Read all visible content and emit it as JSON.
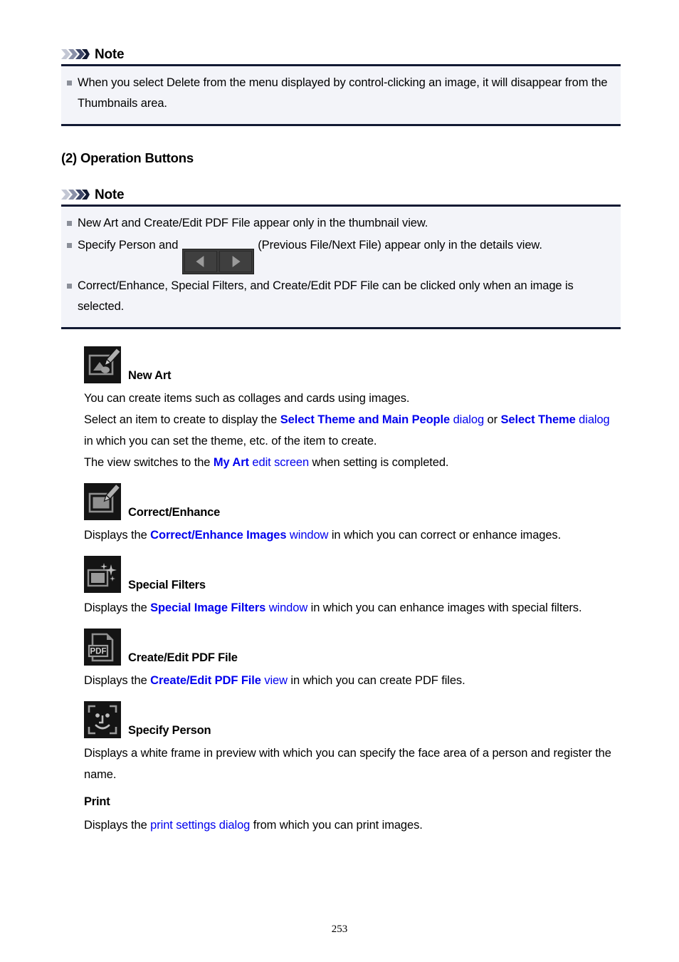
{
  "note1": {
    "title": "Note",
    "icon": "chevrons-right-icon",
    "items": [
      {
        "parts": [
          {
            "t": "When you select ",
            "s": "plain"
          },
          {
            "t": "Delete",
            "s": "bold"
          },
          {
            "t": " from the menu displayed by control-clicking an image, it will disappear from the Thumbnails area.",
            "s": "plain"
          }
        ]
      }
    ]
  },
  "section": {
    "heading": "(2) Operation Buttons"
  },
  "note2": {
    "title": "Note",
    "icon": "chevrons-right-icon",
    "items": [
      {
        "parts": [
          {
            "t": "New Art",
            "s": "bold"
          },
          {
            "t": " and ",
            "s": "plain"
          },
          {
            "t": "Create/Edit PDF File",
            "s": "bold"
          },
          {
            "t": " appear only in the thumbnail view.",
            "s": "plain"
          }
        ]
      },
      {
        "parts": [
          {
            "t": "Specify Person",
            "s": "bold"
          },
          {
            "t": " and ",
            "s": "plain"
          },
          {
            "t": "",
            "s": "navbuttons"
          },
          {
            "t": " (Previous File/Next File) appear only in the details view.",
            "s": "plain"
          }
        ]
      },
      {
        "parts": [
          {
            "t": "Correct/Enhance",
            "s": "bold"
          },
          {
            "t": ", ",
            "s": "plain"
          },
          {
            "t": "Special Filters",
            "s": "bold"
          },
          {
            "t": ", and ",
            "s": "plain"
          },
          {
            "t": "Create/Edit PDF File",
            "s": "bold"
          },
          {
            "t": " can be clicked only when an image is selected.",
            "s": "plain"
          }
        ]
      }
    ],
    "nav_buttons": {
      "previous_label": "Previous File",
      "next_label": "Next File",
      "previous_icon": "arrow-left-icon",
      "next_icon": "arrow-right-icon"
    }
  },
  "buttons": [
    {
      "icon": "new-art-icon",
      "label": "New Art",
      "description_parts": [
        {
          "t": "You can create items such as collages and cards using images.",
          "s": "plain"
        },
        {
          "t": "\n",
          "s": "break"
        },
        {
          "t": "Select an item to create to display the ",
          "s": "plain"
        },
        {
          "t": "Select Theme and Main People",
          "s": "link-bold"
        },
        {
          "t": " dialog",
          "s": "link"
        },
        {
          "t": " or ",
          "s": "plain"
        },
        {
          "t": "Select Theme",
          "s": "link-bold"
        },
        {
          "t": " dialog",
          "s": "link"
        },
        {
          "t": " in which you can set the theme, etc. of the item to create.",
          "s": "plain"
        },
        {
          "t": "\n",
          "s": "break"
        },
        {
          "t": "The view switches to the ",
          "s": "plain"
        },
        {
          "t": "My Art",
          "s": "link-bold"
        },
        {
          "t": " edit screen",
          "s": "link"
        },
        {
          "t": " when setting is completed.",
          "s": "plain"
        }
      ]
    },
    {
      "icon": "correct-enhance-icon",
      "label": "Correct/Enhance",
      "description_parts": [
        {
          "t": "Displays the ",
          "s": "plain"
        },
        {
          "t": "Correct/Enhance Images",
          "s": "link-bold"
        },
        {
          "t": " window",
          "s": "link"
        },
        {
          "t": " in which you can correct or enhance images.",
          "s": "plain"
        }
      ]
    },
    {
      "icon": "special-filters-icon",
      "label": "Special Filters",
      "description_parts": [
        {
          "t": "Displays the ",
          "s": "plain"
        },
        {
          "t": "Special Image Filters",
          "s": "link-bold"
        },
        {
          "t": " window",
          "s": "link"
        },
        {
          "t": " in which you can enhance images with special filters.",
          "s": "plain"
        }
      ]
    },
    {
      "icon": "create-edit-pdf-icon",
      "label": "Create/Edit PDF File",
      "description_parts": [
        {
          "t": "Displays the ",
          "s": "plain"
        },
        {
          "t": "Create/Edit PDF File",
          "s": "link-bold"
        },
        {
          "t": " view",
          "s": "link"
        },
        {
          "t": " in which you can create PDF files.",
          "s": "plain"
        }
      ]
    },
    {
      "icon": "specify-person-icon",
      "label": "Specify Person",
      "description_parts": [
        {
          "t": "Displays a white frame in preview with which you can specify the face area of a person and register the name.",
          "s": "plain"
        }
      ]
    },
    {
      "icon": null,
      "label": "Print",
      "description_parts": [
        {
          "t": "Displays the ",
          "s": "plain"
        },
        {
          "t": "print settings dialog",
          "s": "link"
        },
        {
          "t": " from which you can print images.",
          "s": "plain"
        }
      ]
    }
  ],
  "footer": {
    "page_number": "253"
  },
  "colors": {
    "link": "#0000ee",
    "note_background": "#f3f4f9",
    "note_rule": "#121a33",
    "icon_background": "#141414",
    "icon_foreground": "#9a9a9a",
    "bullet": "#8b8f99"
  }
}
